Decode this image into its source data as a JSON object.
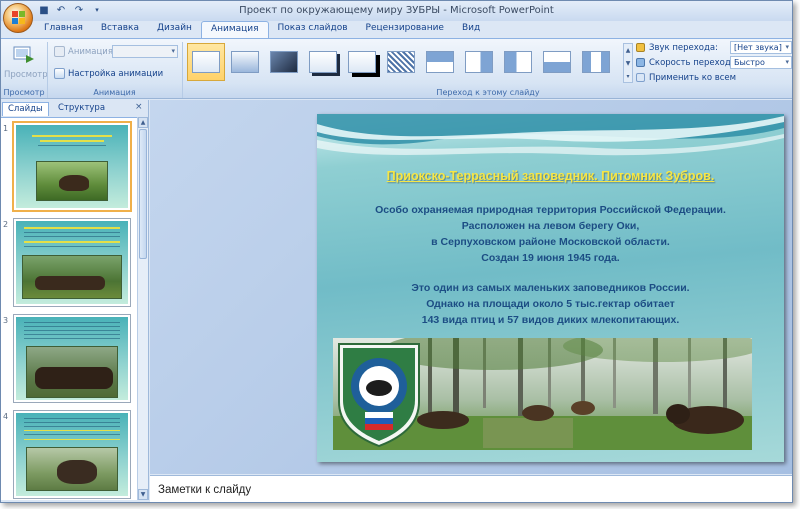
{
  "window": {
    "title": "Проект по окружающему миру ЗУБРЫ - Microsoft PowerPoint"
  },
  "tabs": [
    {
      "label": "Главная"
    },
    {
      "label": "Вставка"
    },
    {
      "label": "Дизайн"
    },
    {
      "label": "Анимация",
      "active": true
    },
    {
      "label": "Показ слайдов"
    },
    {
      "label": "Рецензирование"
    },
    {
      "label": "Вид"
    }
  ],
  "ribbon": {
    "preview": {
      "button_label": "Просмотр",
      "group_label": "Просмотр"
    },
    "animation": {
      "anim_label": "Анимация:",
      "anim_value": "",
      "settings_label": "Настройка анимации",
      "group_label": "Анимация"
    },
    "transition": {
      "group_label": "Переход к этому слайду",
      "sound_label": "Звук перехода:",
      "sound_value": "[Нет звука]",
      "speed_label": "Скорость перехода:",
      "speed_value": "Быстро",
      "apply_all_label": "Применить ко всем"
    }
  },
  "left_panel": {
    "tab_slides": "Слайды",
    "tab_outline": "Структура",
    "close_glyph": "×",
    "slides": [
      {
        "number": "1",
        "selected": true
      },
      {
        "number": "2",
        "selected": false
      },
      {
        "number": "3",
        "selected": false
      },
      {
        "number": "4",
        "selected": false
      }
    ]
  },
  "slide": {
    "title": "Приокско-Террасный заповедник. Питомник Зубров.",
    "lines_1": [
      "Особо охраняемая природная территория Российской Федерации.",
      "Расположен на левом берегу Оки,",
      "в Серпуховском районе Московской области.",
      "Создан 19 июня 1945 года."
    ],
    "lines_2": [
      "Это один из самых маленьких заповедников России.",
      "Однако на площади около 5 тыс.гектар обитает",
      "143 вида птиц и 57 видов диких млекопитающих."
    ]
  },
  "notes": {
    "placeholder": "Заметки к слайду"
  },
  "colors": {
    "ribbon_accent": "#15428b",
    "slide_title": "#f7e645",
    "slide_text": "#1c4d84",
    "selection": "#f0b04a"
  }
}
